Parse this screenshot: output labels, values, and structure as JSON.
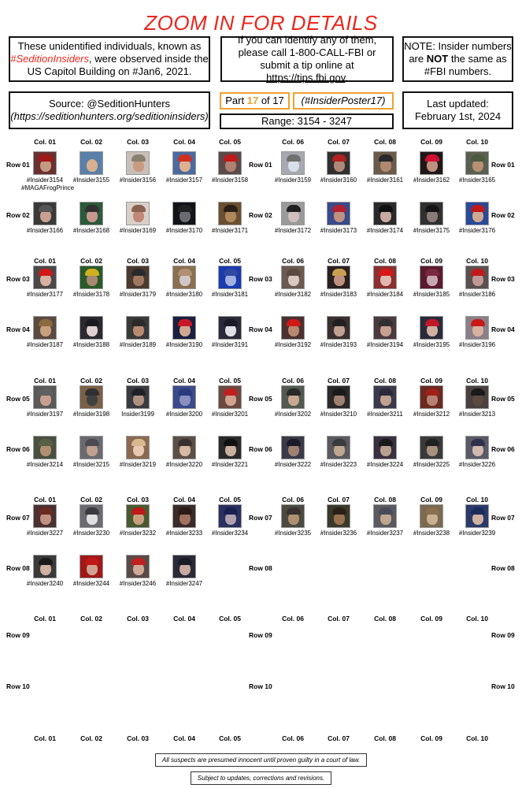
{
  "title": "ZOOM IN FOR DETAILS",
  "info": {
    "left_pre": "These unidentified individuals, known as",
    "left_hashtag": "#SeditionInsiders",
    "left_post": ", were observed inside the US Capitol Building on #Jan6, 2021.",
    "middle_pre": "If you can identify any of them, please call 1-800-CALL-FBI or submit a tip online at",
    "middle_link": "https://tips.fbi.gov",
    "middle_post": ".",
    "note_pre": "NOTE:  Insider numbers are",
    "note_bold": "NOT",
    "note_post": "the same as #FBI numbers.",
    "source_line1": "Source: @SeditionHunters",
    "source_line2": "(https://seditionhunters.org/seditioninsiders)",
    "part_prefix": "Part",
    "part_number": "17",
    "part_suffix": "of 17",
    "poster_tag": "(#InsiderPoster17)",
    "range": "Range: 3154 - 3247",
    "updated_label": "Last updated:",
    "updated_date": "February 1st, 2024"
  },
  "columns": [
    "Col. 01",
    "Col. 02",
    "Col. 03",
    "Col. 04",
    "Col. 05",
    "Col. 06",
    "Col. 07",
    "Col. 08",
    "Col. 09",
    "Col. 10"
  ],
  "rows": [
    "Row 01",
    "Row 02",
    "Row 03",
    "Row 04",
    "Row 05",
    "Row 06",
    "Row 07",
    "Row 08",
    "Row 09",
    "Row 10"
  ],
  "cells": [
    {
      "row": 1,
      "col": 1,
      "label": "#Insider3154",
      "alias": "#MAGAFrogPrince",
      "bg": "#6a3030",
      "skin": "#c49a80",
      "hat": "#a01818"
    },
    {
      "row": 1,
      "col": 2,
      "label": "#Insider3155",
      "bg": "#5a7fa8",
      "skin": "#d8b090",
      "hat": ""
    },
    {
      "row": 1,
      "col": 3,
      "label": "#Insider3156",
      "bg": "#c8c0b8",
      "skin": "#c89a80",
      "hat": "#8a8070"
    },
    {
      "row": 1,
      "col": 4,
      "label": "#Insider3157",
      "bg": "#4a6aa0",
      "skin": "#e0b090",
      "hat": "#d03020"
    },
    {
      "row": 1,
      "col": 5,
      "label": "#Insider3158",
      "bg": "#5a4a4a",
      "skin": "#b08070",
      "hat": "#c01a1a"
    },
    {
      "row": 1,
      "col": 6,
      "label": "#Insider3159",
      "bg": "#a8a8b0",
      "skin": "#d8e0ea",
      "hat": "#707070"
    },
    {
      "row": 1,
      "col": 7,
      "label": "#Insider3160",
      "bg": "#303030",
      "skin": "#b08878",
      "hat": "#b02020"
    },
    {
      "row": 1,
      "col": 8,
      "label": "#Insider3161",
      "bg": "#6a5a4a",
      "skin": "#b08870",
      "hat": "#2a2a2a"
    },
    {
      "row": 1,
      "col": 9,
      "label": "#Insider3162",
      "bg": "#201818",
      "skin": "#c09080",
      "hat": "#d01030"
    },
    {
      "row": 1,
      "col": 10,
      "label": "#Insider3165",
      "bg": "#5a6050",
      "skin": "#b89070",
      "hat": "#4a5a40"
    },
    {
      "row": 2,
      "col": 1,
      "label": "#Insider3166",
      "bg": "#3a3a3a",
      "skin": "#c8a090",
      "hat": "#555555"
    },
    {
      "row": 2,
      "col": 2,
      "label": "#Insider3168",
      "bg": "#2a5a3a",
      "skin": "#c89890",
      "hat": "#303030"
    },
    {
      "row": 2,
      "col": 3,
      "label": "#Insider3169",
      "bg": "#d8d0c8",
      "skin": "#c08878",
      "hat": "#8a6050"
    },
    {
      "row": 2,
      "col": 4,
      "label": "#Insider3170",
      "bg": "#101418",
      "skin": "#6a6a70",
      "hat": "#202020"
    },
    {
      "row": 2,
      "col": 5,
      "label": "#Insider3171",
      "bg": "#6a5030",
      "skin": "#b08860",
      "hat": "#2a2018"
    },
    {
      "row": 2,
      "col": 6,
      "label": "#Insider3172",
      "bg": "#9a9a9a",
      "skin": "#d0c0c0",
      "hat": "#202020"
    },
    {
      "row": 2,
      "col": 7,
      "label": "#Insider3173",
      "bg": "#3a4a8a",
      "skin": "#c09080",
      "hat": "#b02030"
    },
    {
      "row": 2,
      "col": 8,
      "label": "#Insider3174",
      "bg": "#2a2a2a",
      "skin": "#c8a8a0",
      "hat": "#101010"
    },
    {
      "row": 2,
      "col": 9,
      "label": "#Insider3175",
      "bg": "#303030",
      "skin": "#8a7a78",
      "hat": "#151515"
    },
    {
      "row": 2,
      "col": 10,
      "label": "#Insider3176",
      "bg": "#2a4a9a",
      "skin": "#d0a890",
      "hat": "#c01818"
    },
    {
      "row": 3,
      "col": 1,
      "label": "#Insider3177",
      "bg": "#4a4848",
      "skin": "#d8b0a0",
      "hat": "#d01818"
    },
    {
      "row": 3,
      "col": 2,
      "label": "#Insider3178",
      "bg": "#2a5a2a",
      "skin": "#a88870",
      "hat": "#d0b020"
    },
    {
      "row": 3,
      "col": 3,
      "label": "#Insider3179",
      "bg": "#4a3a30",
      "skin": "#a07860",
      "hat": "#2a2a2a"
    },
    {
      "row": 3,
      "col": 4,
      "label": "#Insider3180",
      "bg": "#8a7050",
      "skin": "#d0c8c8",
      "hat": "#b09070"
    },
    {
      "row": 3,
      "col": 5,
      "label": "#Insider3181",
      "bg": "#1a3ab0",
      "skin": "#a0b0e0",
      "hat": "#304aa0"
    },
    {
      "row": 3,
      "col": 6,
      "label": "#Insider3182",
      "bg": "#6a5a50",
      "skin": "#d8c8c0",
      "hat": "#5a4a40"
    },
    {
      "row": 3,
      "col": 7,
      "label": "#Insider3183",
      "bg": "#2a2020",
      "skin": "#c09080",
      "hat": "#c8a050"
    },
    {
      "row": 3,
      "col": 8,
      "label": "#Insider3184",
      "bg": "#8a3030",
      "skin": "#e0b8b0",
      "hat": "#d81818"
    },
    {
      "row": 3,
      "col": 9,
      "label": "#Insider3185",
      "bg": "#5a1a30",
      "skin": "#c8a8b0",
      "hat": "#7a2a40"
    },
    {
      "row": 3,
      "col": 10,
      "label": "#Insider3186",
      "bg": "#5a5050",
      "skin": "#c09898",
      "hat": "#c01a1a"
    },
    {
      "row": 4,
      "col": 1,
      "label": "#Insider3187",
      "bg": "#5a4a40",
      "skin": "#c8a080",
      "hat": "#8a6a40"
    },
    {
      "row": 4,
      "col": 2,
      "label": "#Insider3188",
      "bg": "#2a2a30",
      "skin": "#e0d0d0",
      "hat": "#1a1a20"
    },
    {
      "row": 4,
      "col": 3,
      "label": "#Insider3189",
      "bg": "#3a3a3a",
      "skin": "#b88a70",
      "hat": "#2a2a2a"
    },
    {
      "row": 4,
      "col": 4,
      "label": "#Insider3190",
      "bg": "#1a2040",
      "skin": "#d0a890",
      "hat": "#c81828"
    },
    {
      "row": 4,
      "col": 5,
      "label": "#Insider3191",
      "bg": "#2a2a3a",
      "skin": "#e0e0e8",
      "hat": "#1a1a28"
    },
    {
      "row": 4,
      "col": 6,
      "label": "#Insider3192",
      "bg": "#4a3030",
      "skin": "#b88870",
      "hat": "#d01818"
    },
    {
      "row": 4,
      "col": 7,
      "label": "#Insider3193",
      "bg": "#3a3030",
      "skin": "#c0a090",
      "hat": "#202020"
    },
    {
      "row": 4,
      "col": 8,
      "label": "#Insider3194",
      "bg": "#4a3a40",
      "skin": "#c8a090",
      "hat": "#303030"
    },
    {
      "row": 4,
      "col": 9,
      "label": "#Insider3195",
      "bg": "#2a2a3a",
      "skin": "#d0b0a0",
      "hat": "#c01828"
    },
    {
      "row": 4,
      "col": 10,
      "label": "#Insider3196",
      "bg": "#8a8088",
      "skin": "#d8b0a0",
      "hat": "#c81818"
    },
    {
      "row": 5,
      "col": 1,
      "label": "#Insider3197",
      "bg": "#5a5a58",
      "skin": "#c8a090",
      "hat": "#606060"
    },
    {
      "row": 5,
      "col": 2,
      "label": "#Insider3198",
      "bg": "#7a6048",
      "skin": "#404040",
      "hat": "#303030"
    },
    {
      "row": 5,
      "col": 3,
      "label": "Insider3199",
      "bg": "#3a3a40",
      "skin": "#b09080",
      "hat": "#202028"
    },
    {
      "row": 5,
      "col": 4,
      "label": "#Insider3200",
      "bg": "#3a4a8a",
      "skin": "#8890c0",
      "hat": "#2a3a80"
    },
    {
      "row": 5,
      "col": 5,
      "label": "#Insider3201",
      "bg": "#6a4a40",
      "skin": "#d0a090",
      "hat": "#c02020"
    },
    {
      "row": 5,
      "col": 6,
      "label": "#Insider3202",
      "bg": "#505a50",
      "skin": "#c8a890",
      "hat": "#2a2a2a"
    },
    {
      "row": 5,
      "col": 7,
      "label": "#Insider3210",
      "bg": "#2a2a2a",
      "skin": "#a08070",
      "hat": "#1a1a1a"
    },
    {
      "row": 5,
      "col": 8,
      "label": "#Insider3211",
      "bg": "#3a3a4a",
      "skin": "#c0a090",
      "hat": "#2a2a3a"
    },
    {
      "row": 5,
      "col": 9,
      "label": "#Insider3212",
      "bg": "#6a2a20",
      "skin": "#b88070",
      "hat": "#a02018"
    },
    {
      "row": 5,
      "col": 10,
      "label": "#Insider3213",
      "bg": "#4a4040",
      "skin": "#5a4a40",
      "hat": "#1a1a1a"
    },
    {
      "row": 6,
      "col": 1,
      "label": "#Insider3214",
      "bg": "#4a5040",
      "skin": "#b09070",
      "hat": "#5a6048"
    },
    {
      "row": 6,
      "col": 2,
      "label": "#Insider3215",
      "bg": "#6a6a70",
      "skin": "#c0a090",
      "hat": "#4a4a50"
    },
    {
      "row": 6,
      "col": 3,
      "label": "#Insider3219",
      "bg": "#8a6a50",
      "skin": "#e8c8b0",
      "hat": "#d8b890"
    },
    {
      "row": 6,
      "col": 4,
      "label": "#Insider3220",
      "bg": "#5a5048",
      "skin": "#d8b8a0",
      "hat": "#3a3030"
    },
    {
      "row": 6,
      "col": 5,
      "label": "#Insider3221",
      "bg": "#2a2a2a",
      "skin": "#c8b0a0",
      "hat": "#101010"
    },
    {
      "row": 6,
      "col": 6,
      "label": "#Insider3222",
      "bg": "#3a3a48",
      "skin": "#a08070",
      "hat": "#1a1a28"
    },
    {
      "row": 6,
      "col": 7,
      "label": "#Insider3223",
      "bg": "#5a5a60",
      "skin": "#c0a890",
      "hat": "#3a3a3a"
    },
    {
      "row": 6,
      "col": 8,
      "label": "#Insider3224",
      "bg": "#3a3040",
      "skin": "#b8a090",
      "hat": "#1a1a1a"
    },
    {
      "row": 6,
      "col": 9,
      "label": "#Insider3225",
      "bg": "#3a3a3a",
      "skin": "#a89080",
      "hat": "#202020"
    },
    {
      "row": 6,
      "col": 10,
      "label": "#Insider3226",
      "bg": "#5a5a68",
      "skin": "#d0b8b0",
      "hat": "#30304a"
    },
    {
      "row": 7,
      "col": 1,
      "label": "#Insider3227",
      "bg": "#4a3030",
      "skin": "#c09080",
      "hat": "#6a2a20"
    },
    {
      "row": 7,
      "col": 2,
      "label": "#Insider3230",
      "bg": "#6a6a70",
      "skin": "#e0e0e0",
      "hat": "#3a3a40"
    },
    {
      "row": 7,
      "col": 3,
      "label": "#Insider3232",
      "bg": "#4a5a30",
      "skin": "#c8a080",
      "hat": "#c01818"
    },
    {
      "row": 7,
      "col": 4,
      "label": "#Insider3233",
      "bg": "#3a2a28",
      "skin": "#a07060",
      "hat": "#2a1a18"
    },
    {
      "row": 7,
      "col": 5,
      "label": "#Insider3234",
      "bg": "#2a3060",
      "skin": "#b0a0b0",
      "hat": "#1a2050"
    },
    {
      "row": 7,
      "col": 6,
      "label": "#Insider3235",
      "bg": "#4a4a40",
      "skin": "#b09070",
      "hat": "#3a3030"
    },
    {
      "row": 7,
      "col": 7,
      "label": "#Insider3236",
      "bg": "#3a3a2a",
      "skin": "#9a7050",
      "hat": "#2a2018"
    },
    {
      "row": 7,
      "col": 8,
      "label": "#Insider3237",
      "bg": "#5a5a60",
      "skin": "#c0a890",
      "hat": "#4a4a58"
    },
    {
      "row": 7,
      "col": 9,
      "label": "#Insider3238",
      "bg": "#7a6a50",
      "skin": "#c8b090",
      "hat": "#8a7050"
    },
    {
      "row": 7,
      "col": 10,
      "label": "#Insider3239",
      "bg": "#2a3a6a",
      "skin": "#d0b0a0",
      "hat": "#1a2a5a"
    },
    {
      "row": 8,
      "col": 1,
      "label": "#Insider3240",
      "bg": "#3a3a3a",
      "skin": "#d0b0a0",
      "hat": "#1a1a1a"
    },
    {
      "row": 8,
      "col": 2,
      "label": "#Insider3244",
      "bg": "#a01818",
      "skin": "#d0a090",
      "hat": "#c01818"
    },
    {
      "row": 8,
      "col": 3,
      "label": "#Insider3246",
      "bg": "#5a4a48",
      "skin": "#d0a898",
      "hat": "#c02020"
    },
    {
      "row": 8,
      "col": 4,
      "label": "#Insider3247",
      "bg": "#2a2a38",
      "skin": "#c8a8a0",
      "hat": "#1a1a28"
    }
  ],
  "footer": {
    "disclaimer": "All suspects are presumed innocent until proven guilty in a court of law.",
    "updates": "Subject to updates, corrections and revisions."
  }
}
